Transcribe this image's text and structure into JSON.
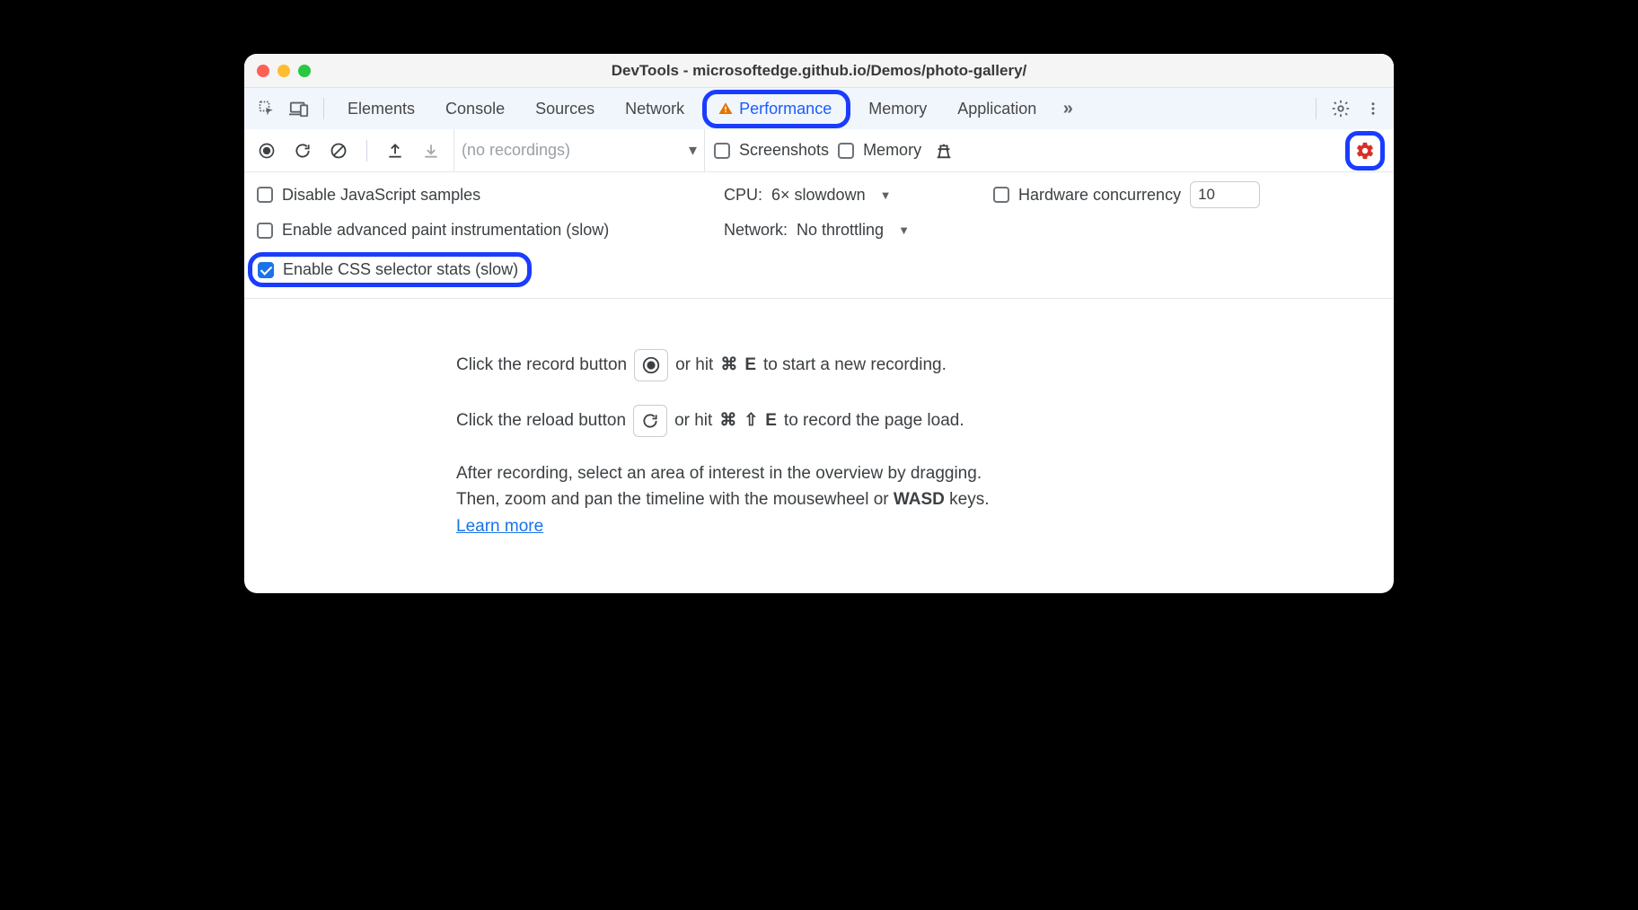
{
  "window": {
    "title": "DevTools - microsoftedge.github.io/Demos/photo-gallery/"
  },
  "tabs": {
    "elements": "Elements",
    "console": "Console",
    "sources": "Sources",
    "network": "Network",
    "performance": "Performance",
    "memory": "Memory",
    "application": "Application"
  },
  "toolbar": {
    "recordings_placeholder": "(no recordings)",
    "screenshots": "Screenshots",
    "memory": "Memory"
  },
  "settings": {
    "disable_js": "Disable JavaScript samples",
    "cpu_label": "CPU:",
    "cpu_value": "6× slowdown",
    "hw_label": "Hardware concurrency",
    "hw_value": "10",
    "paint_instr": "Enable advanced paint instrumentation (slow)",
    "network_label": "Network:",
    "network_value": "No throttling",
    "css_stats": "Enable CSS selector stats (slow)"
  },
  "content": {
    "l1a": "Click the record button",
    "l1b": "or hit",
    "l1c": "⌘",
    "l1d": "E",
    "l1e": "to start a new recording.",
    "l2a": "Click the reload button",
    "l2b": "or hit",
    "l2c": "⌘",
    "l2d": "⇧",
    "l2e": "E",
    "l2f": "to record the page load.",
    "l3a": "After recording, select an area of interest in the overview by dragging.",
    "l3b": "Then, zoom and pan the timeline with the mousewheel or",
    "l3c": "WASD",
    "l3d": "keys.",
    "learn": "Learn more"
  }
}
